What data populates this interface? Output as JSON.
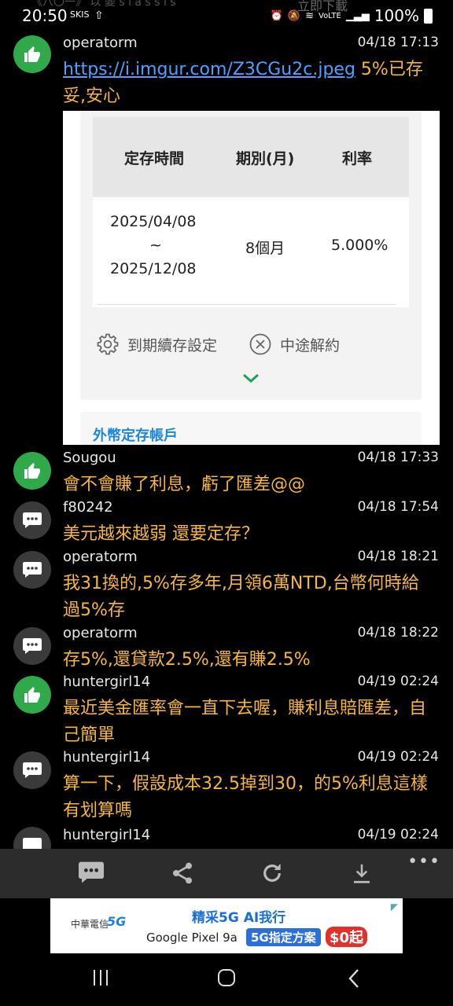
{
  "status": {
    "time": "20:50",
    "carrier_icon": "SKIS",
    "battery": "100%",
    "faint_left": "《八〇一》 以 變 s l a s s i s",
    "faint_right": "立即下載"
  },
  "posts": [
    {
      "user": "operatorm",
      "time": "04/18 17:13",
      "link": "https://i.imgur.com/Z3CGu2c.jpeg",
      "text": " 5%已存妥,安心",
      "avatar": "thumbs-up-icon"
    },
    {
      "user": "Sougou",
      "time": "04/18 17:33",
      "text": "會不會賺了利息，虧了匯差@@",
      "avatar": "thumbs-up-icon"
    },
    {
      "user": "f80242",
      "time": "04/18 17:54",
      "text": "美元越來越弱 還要定存？",
      "avatar": "comment-icon"
    },
    {
      "user": "operatorm",
      "time": "04/18 18:21",
      "text": "我31換的,5%存多年,月領6萬NTD,台幣何時給過5%存",
      "avatar": "comment-icon"
    },
    {
      "user": "operatorm",
      "time": "04/18 18:22",
      "text": "存5%,還貸款2.5%,還有賺2.5%",
      "avatar": "comment-icon"
    },
    {
      "user": "huntergirl14",
      "time": "04/19 02:24",
      "text": "最近美金匯率會一直下去喔，賺利息賠匯差，自己簡單",
      "avatar": "thumbs-up-icon"
    },
    {
      "user": "huntergirl14",
      "time": "04/19 02:24",
      "text": "算一下，假設成本32.5掉到30，的5%利息這樣有划算嗎",
      "avatar": "comment-icon"
    },
    {
      "user": "huntergirl14",
      "time": "04/19 02:24",
      "text": "",
      "avatar": "comment-icon"
    }
  ],
  "screenshot": {
    "headers": [
      "定存時間",
      "期別(月)",
      "利率"
    ],
    "row": {
      "start": "2025/04/08",
      "tilde": "~",
      "end": "2025/12/08",
      "period": "8個月",
      "rate": "5.000%"
    },
    "renew": "到期續存設定",
    "cancel": "中途解約",
    "next_card": "外幣定存帳戶"
  },
  "ad": {
    "brand": "中華電信",
    "fiveg": "5G",
    "slogan": "精采5G AI我行",
    "phone": "Google Pixel 9a",
    "plan": "5G指定方案",
    "zero": "$0起"
  },
  "colors": {
    "accent_text": "#f5b642",
    "link": "#4fa0ff",
    "like_green": "#30a94a"
  }
}
